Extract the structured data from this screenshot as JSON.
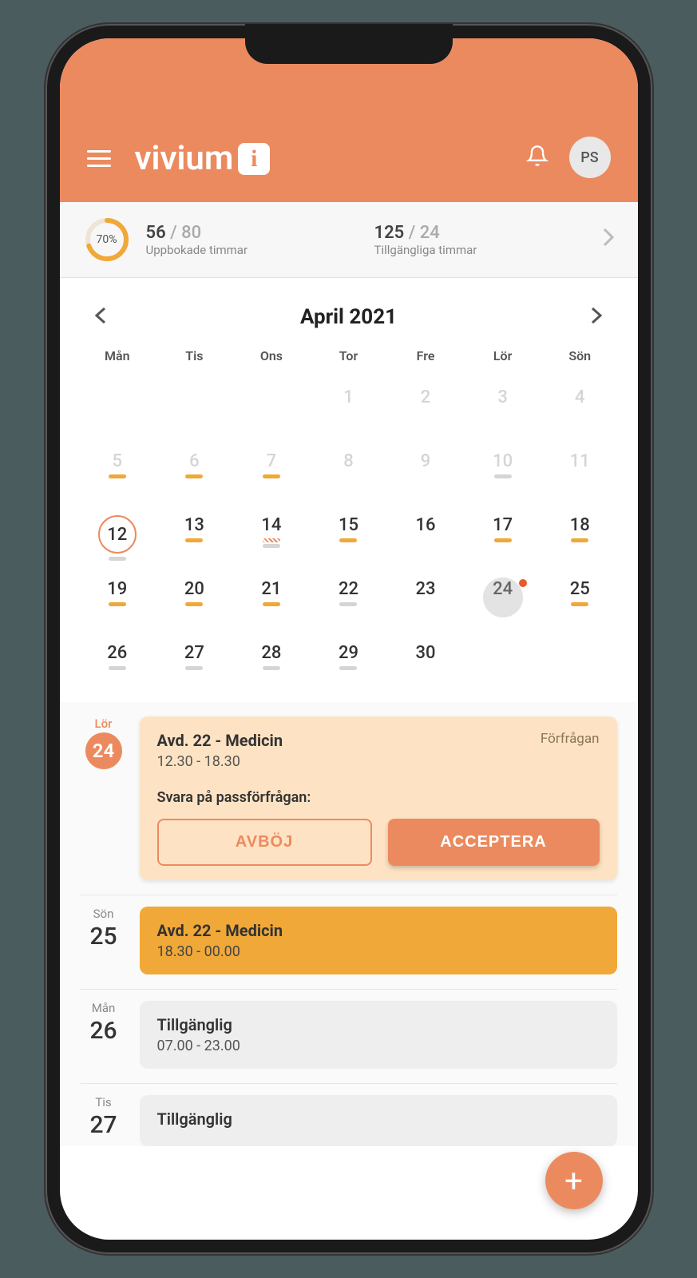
{
  "header": {
    "logo_text": "vivium",
    "logo_badge": "i",
    "avatar_initials": "PS"
  },
  "stats": {
    "progress_pct": "70%",
    "booked_value": "56",
    "booked_total": "80",
    "booked_label": "Uppbokade timmar",
    "avail_value": "125",
    "avail_total": "24",
    "avail_label": "Tillgängliga timmar"
  },
  "calendar": {
    "title": "April 2021",
    "day_headers": [
      "Mån",
      "Tis",
      "Ons",
      "Tor",
      "Fre",
      "Lör",
      "Sön"
    ],
    "cells": [
      {
        "n": "",
        "prev": true
      },
      {
        "n": "",
        "prev": true
      },
      {
        "n": "",
        "prev": true
      },
      {
        "n": "1",
        "prev": true
      },
      {
        "n": "2",
        "prev": true
      },
      {
        "n": "3",
        "prev": true
      },
      {
        "n": "4",
        "prev": true
      },
      {
        "n": "5",
        "prev": true,
        "u": "orange"
      },
      {
        "n": "6",
        "prev": true,
        "u": "orange"
      },
      {
        "n": "7",
        "prev": true,
        "u": "orange"
      },
      {
        "n": "8",
        "prev": true
      },
      {
        "n": "9",
        "prev": true
      },
      {
        "n": "10",
        "prev": true,
        "u": "gray"
      },
      {
        "n": "11",
        "prev": true
      },
      {
        "n": "12",
        "ring": true,
        "u": "gray"
      },
      {
        "n": "13",
        "u": "orange"
      },
      {
        "n": "14",
        "u": "pat",
        "u2": "gray"
      },
      {
        "n": "15",
        "u": "orange"
      },
      {
        "n": "16"
      },
      {
        "n": "17",
        "u": "orange"
      },
      {
        "n": "18",
        "u": "orange"
      },
      {
        "n": "19",
        "u": "orange"
      },
      {
        "n": "20",
        "u": "orange"
      },
      {
        "n": "21",
        "u": "orange"
      },
      {
        "n": "22",
        "u": "gray"
      },
      {
        "n": "23"
      },
      {
        "n": "24",
        "selected": true,
        "dot": true,
        "u": "orange"
      },
      {
        "n": "25",
        "u": "orange"
      },
      {
        "n": "26",
        "u": "gray"
      },
      {
        "n": "27",
        "u": "gray"
      },
      {
        "n": "28",
        "u": "gray"
      },
      {
        "n": "29",
        "u": "gray"
      },
      {
        "n": "30"
      },
      {
        "n": ""
      },
      {
        "n": ""
      }
    ]
  },
  "events": [
    {
      "day_name": "Lör",
      "day_num": "24",
      "badge": true,
      "card_type": "request",
      "title": "Avd. 22 - Medicin",
      "status": "Förfrågan",
      "time": "12.30 - 18.30",
      "prompt": "Svara på passförfrågan:",
      "decline": "AVBÖJ",
      "accept": "ACCEPTERA"
    },
    {
      "day_name": "Sön",
      "day_num": "25",
      "card_type": "booked",
      "title": "Avd. 22 - Medicin",
      "time": "18.30 - 00.00"
    },
    {
      "day_name": "Mån",
      "day_num": "26",
      "card_type": "available",
      "title": "Tillgänglig",
      "time": "07.00 - 23.00"
    },
    {
      "day_name": "Tis",
      "day_num": "27",
      "card_type": "available",
      "title": "Tillgänglig",
      "time": ""
    }
  ],
  "fab": "+"
}
